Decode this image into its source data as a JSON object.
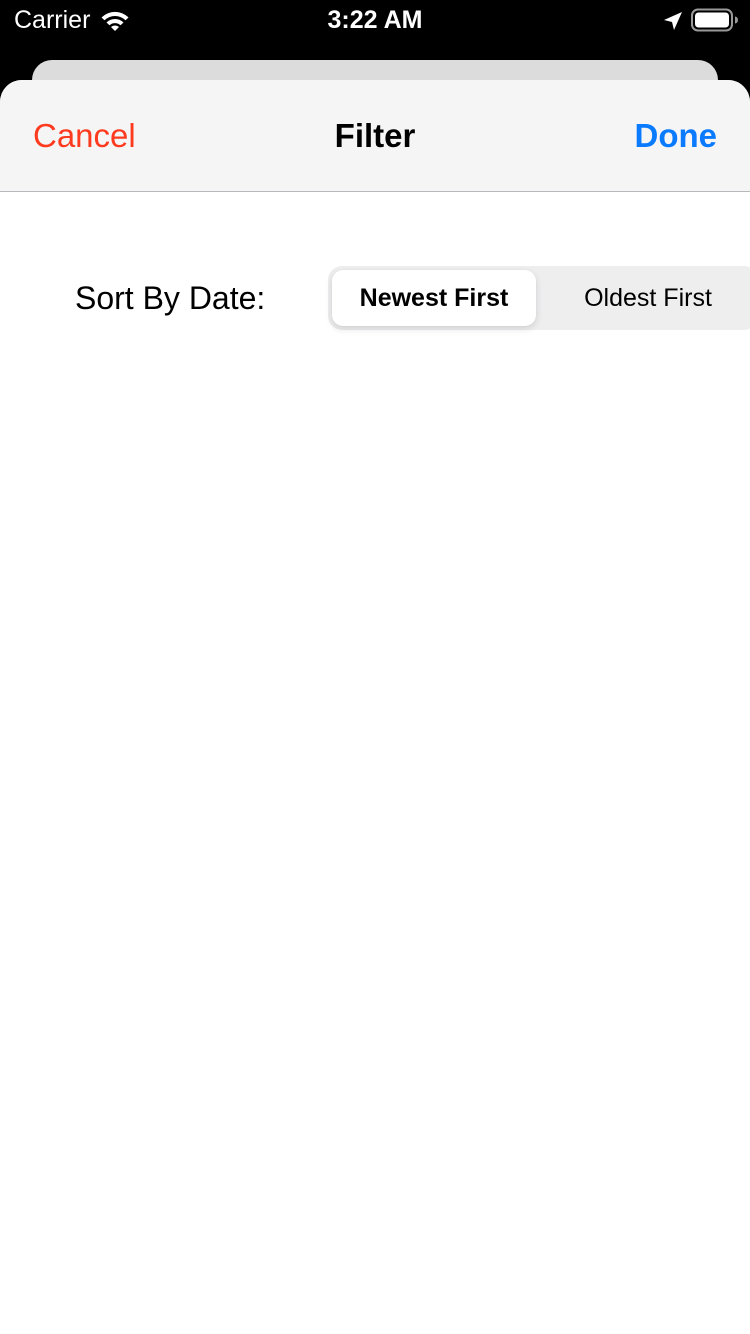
{
  "status_bar": {
    "carrier": "Carrier",
    "time": "3:22 AM",
    "icons": [
      "wifi-icon",
      "location-arrow-icon",
      "battery-icon"
    ]
  },
  "nav": {
    "cancel_label": "Cancel",
    "title": "Filter",
    "done_label": "Done"
  },
  "filter": {
    "sort_label": "Sort By Date:",
    "segments": [
      {
        "label": "Newest First",
        "selected": true
      },
      {
        "label": "Oldest First",
        "selected": false
      }
    ]
  },
  "colors": {
    "cancel": "#ff3b1f",
    "done": "#0a7aff",
    "nav_background": "#f5f5f6",
    "segment_background": "#eeeeef"
  }
}
